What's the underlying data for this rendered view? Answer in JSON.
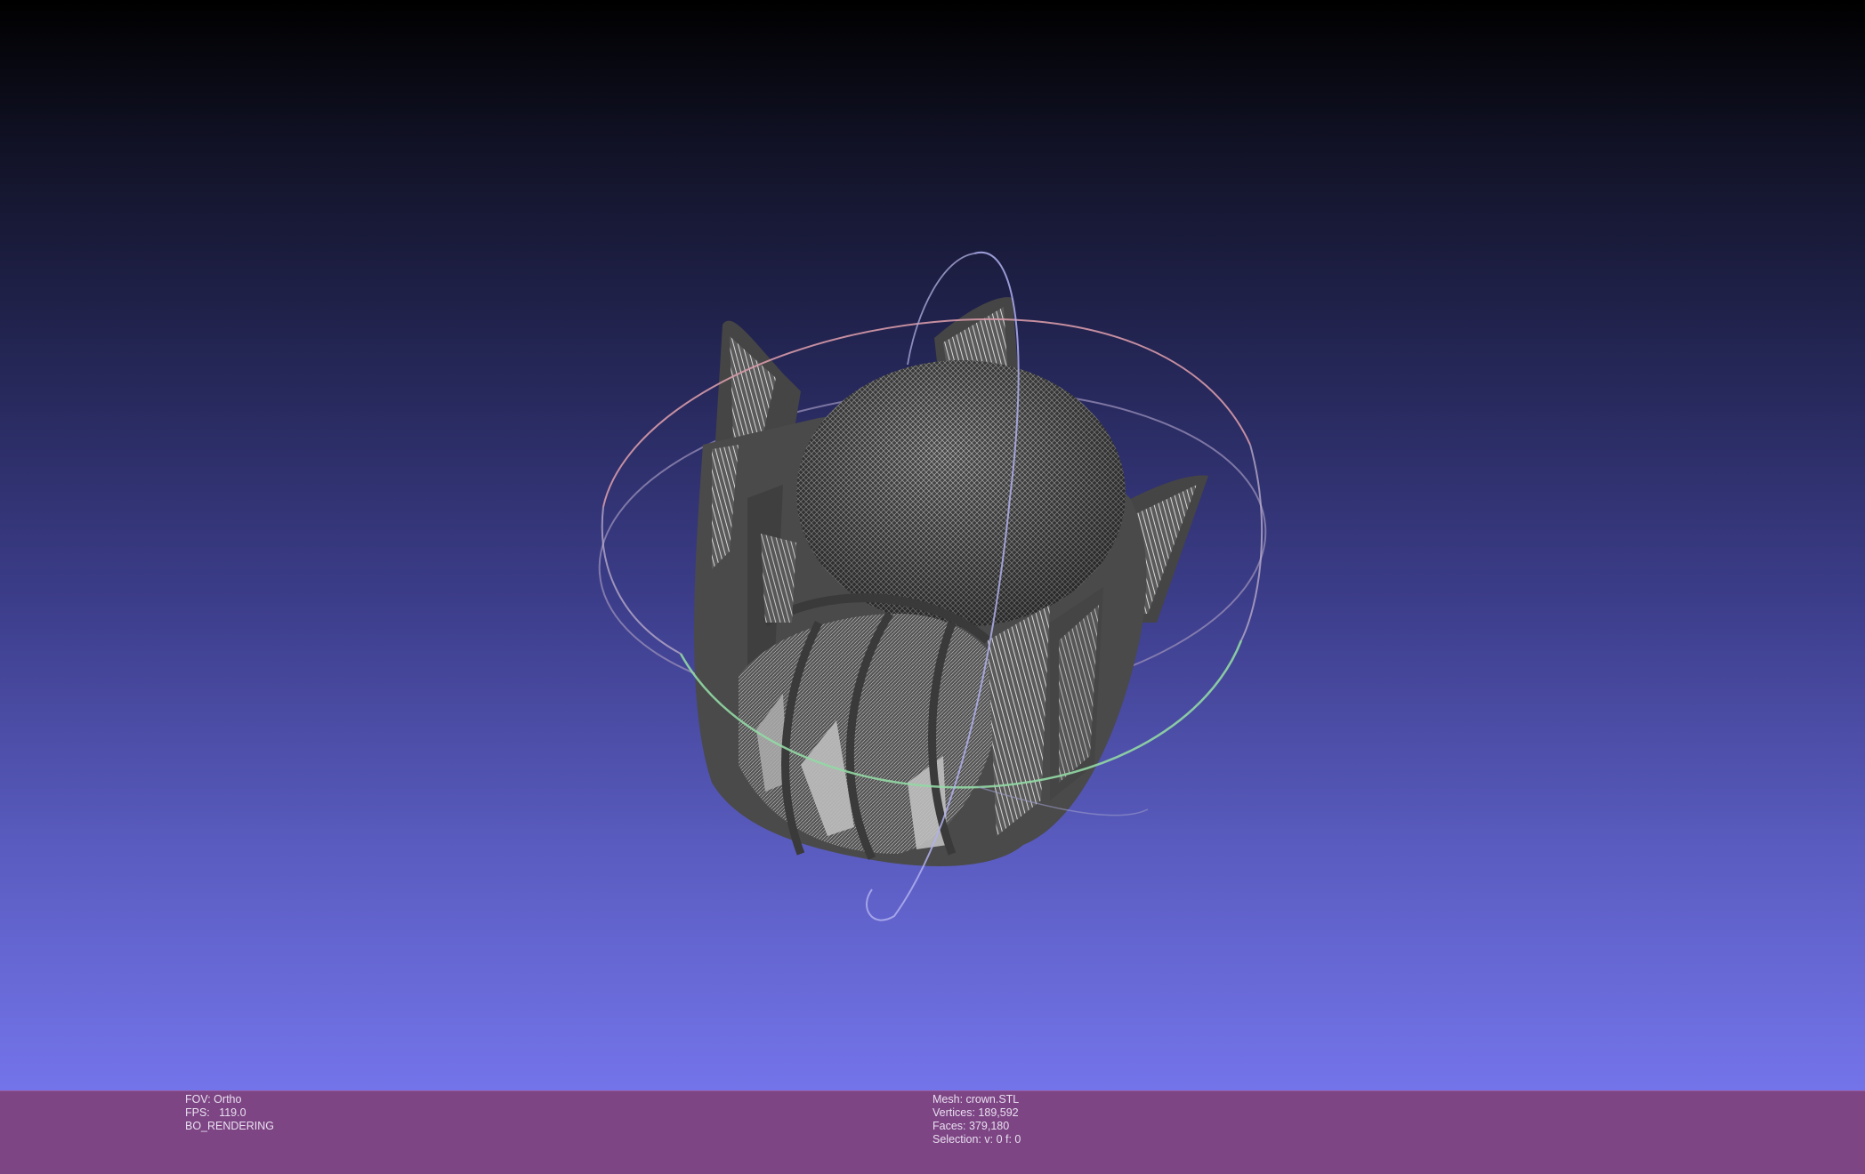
{
  "viewport": {
    "background_top": "#000000",
    "background_bottom": "#7474ea",
    "mesh_color": "#4a4a4a",
    "wire_color": "#bdbdbd",
    "trackball_colors": {
      "x_ring": "#d79aa8",
      "y_ring": "#a9a9e8",
      "z_ring": "#92d8a4"
    }
  },
  "status_bar": {
    "background": "#7d4584",
    "left": {
      "fov": "FOV: Ortho",
      "fps": "FPS:   119.0",
      "mode": "BO_RENDERING"
    },
    "mesh_info": {
      "mesh": "Mesh: crown.STL",
      "vertices": "Vertices: 189,592",
      "faces": "Faces: 379,180",
      "selection": "Selection: v: 0 f: 0"
    }
  }
}
